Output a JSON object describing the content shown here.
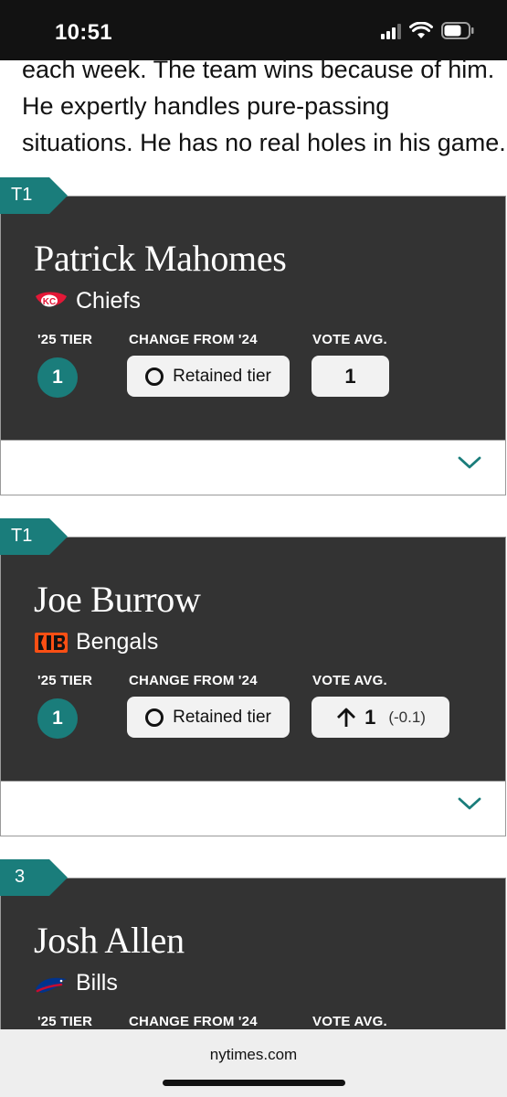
{
  "status_bar": {
    "time": "10:51"
  },
  "article": {
    "lines": [
      "each week. The team wins because of him.",
      "He expertly handles pure-passing",
      "situations. He has no real holes in his game."
    ]
  },
  "labels": {
    "tier_25": "'25 TIER",
    "change": "CHANGE FROM '24",
    "vote_avg": "VOTE AVG."
  },
  "players": [
    {
      "tab": "T1",
      "name": "Patrick Mahomes",
      "team": "Chiefs",
      "tier": "1",
      "change": "Retained tier",
      "vote_avg": "1",
      "vote_delta": ""
    },
    {
      "tab": "T1",
      "name": "Joe Burrow",
      "team": "Bengals",
      "tier": "1",
      "change": "Retained tier",
      "vote_avg": "1",
      "vote_delta": "(-0.1)"
    },
    {
      "tab": "3",
      "name": "Josh Allen",
      "team": "Bills"
    }
  ],
  "browser": {
    "domain": "nytimes.com"
  },
  "colors": {
    "teal": "#1a7d7b",
    "card_bg": "#333333",
    "pill_bg": "#f2f2f2"
  },
  "icons": [
    "signal-icon",
    "wifi-icon",
    "battery-icon",
    "chiefs-logo-icon",
    "bengals-logo-icon",
    "bills-logo-icon",
    "ring-icon",
    "arrow-up-icon",
    "chevron-down-icon"
  ]
}
